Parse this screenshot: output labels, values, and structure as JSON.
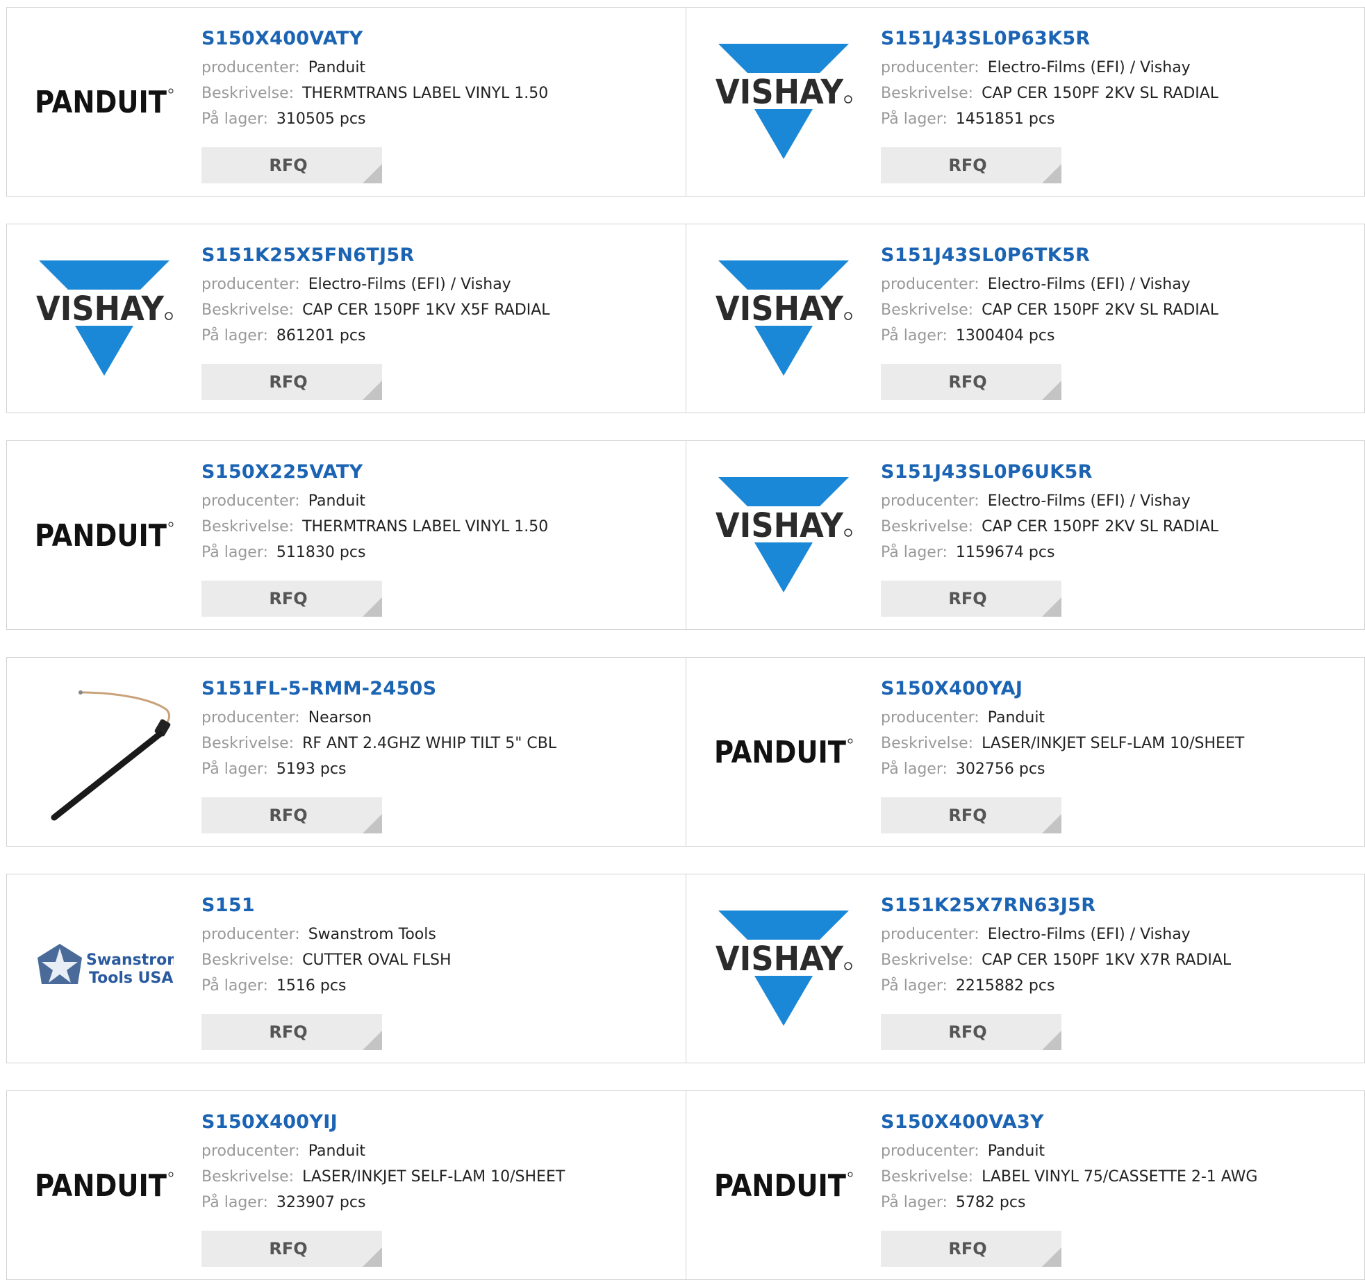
{
  "labels": {
    "manufacturer": "producenter:",
    "description": "Beskrivelse:",
    "stock": "På lager:",
    "rfq": "RFQ"
  },
  "colors": {
    "part_link": "#1b63b3",
    "vishay_blue": "#1a88d6",
    "rfq_bg": "#ebebeb"
  },
  "rows": [
    [
      {
        "part": "S150X400VATY",
        "manufacturer": "Panduit",
        "description": "THERMTRANS LABEL VINYL 1.50",
        "stock": "310505 pcs",
        "logo": "panduit-logo"
      },
      {
        "part": "S151J43SL0P63K5R",
        "manufacturer": "Electro-Films (EFI) / Vishay",
        "description": "CAP CER 150PF 2KV SL RADIAL",
        "stock": "1451851 pcs",
        "logo": "vishay-logo"
      }
    ],
    [
      {
        "part": "S151K25X5FN6TJ5R",
        "manufacturer": "Electro-Films (EFI) / Vishay",
        "description": "CAP CER 150PF 1KV X5F RADIAL",
        "stock": "861201 pcs",
        "logo": "vishay-logo"
      },
      {
        "part": "S151J43SL0P6TK5R",
        "manufacturer": "Electro-Films (EFI) / Vishay",
        "description": "CAP CER 150PF 2KV SL RADIAL",
        "stock": "1300404 pcs",
        "logo": "vishay-logo"
      }
    ],
    [
      {
        "part": "S150X225VATY",
        "manufacturer": "Panduit",
        "description": "THERMTRANS LABEL VINYL 1.50",
        "stock": "511830 pcs",
        "logo": "panduit-logo"
      },
      {
        "part": "S151J43SL0P6UK5R",
        "manufacturer": "Electro-Films (EFI) / Vishay",
        "description": "CAP CER 150PF 2KV SL RADIAL",
        "stock": "1159674 pcs",
        "logo": "vishay-logo"
      }
    ],
    [
      {
        "part": "S151FL-5-RMM-2450S",
        "manufacturer": "Nearson",
        "description": "RF ANT 2.4GHZ WHIP TILT 5\" CBL",
        "stock": "5193 pcs",
        "logo": "antenna-image"
      },
      {
        "part": "S150X400YAJ",
        "manufacturer": "Panduit",
        "description": "LASER/INKJET SELF-LAM 10/SHEET",
        "stock": "302756 pcs",
        "logo": "panduit-logo"
      }
    ],
    [
      {
        "part": "S151",
        "manufacturer": "Swanstrom Tools",
        "description": "CUTTER OVAL FLSH",
        "stock": "1516 pcs",
        "logo": "swanstrom-logo"
      },
      {
        "part": "S151K25X7RN63J5R",
        "manufacturer": "Electro-Films (EFI) / Vishay",
        "description": "CAP CER 150PF 1KV X7R RADIAL",
        "stock": "2215882 pcs",
        "logo": "vishay-logo"
      }
    ],
    [
      {
        "part": "S150X400YIJ",
        "manufacturer": "Panduit",
        "description": "LASER/INKJET SELF-LAM 10/SHEET",
        "stock": "323907 pcs",
        "logo": "panduit-logo"
      },
      {
        "part": "S150X400VA3Y",
        "manufacturer": "Panduit",
        "description": "LABEL VINYL 75/CASSETTE 2-1 AWG",
        "stock": "5782 pcs",
        "logo": "panduit-logo"
      }
    ]
  ],
  "logo_text": {
    "panduit": "PANDUIT",
    "vishay": "VISHAY",
    "swanstrom_line1": "Swanstrom",
    "swanstrom_line2": "Tools USA"
  }
}
